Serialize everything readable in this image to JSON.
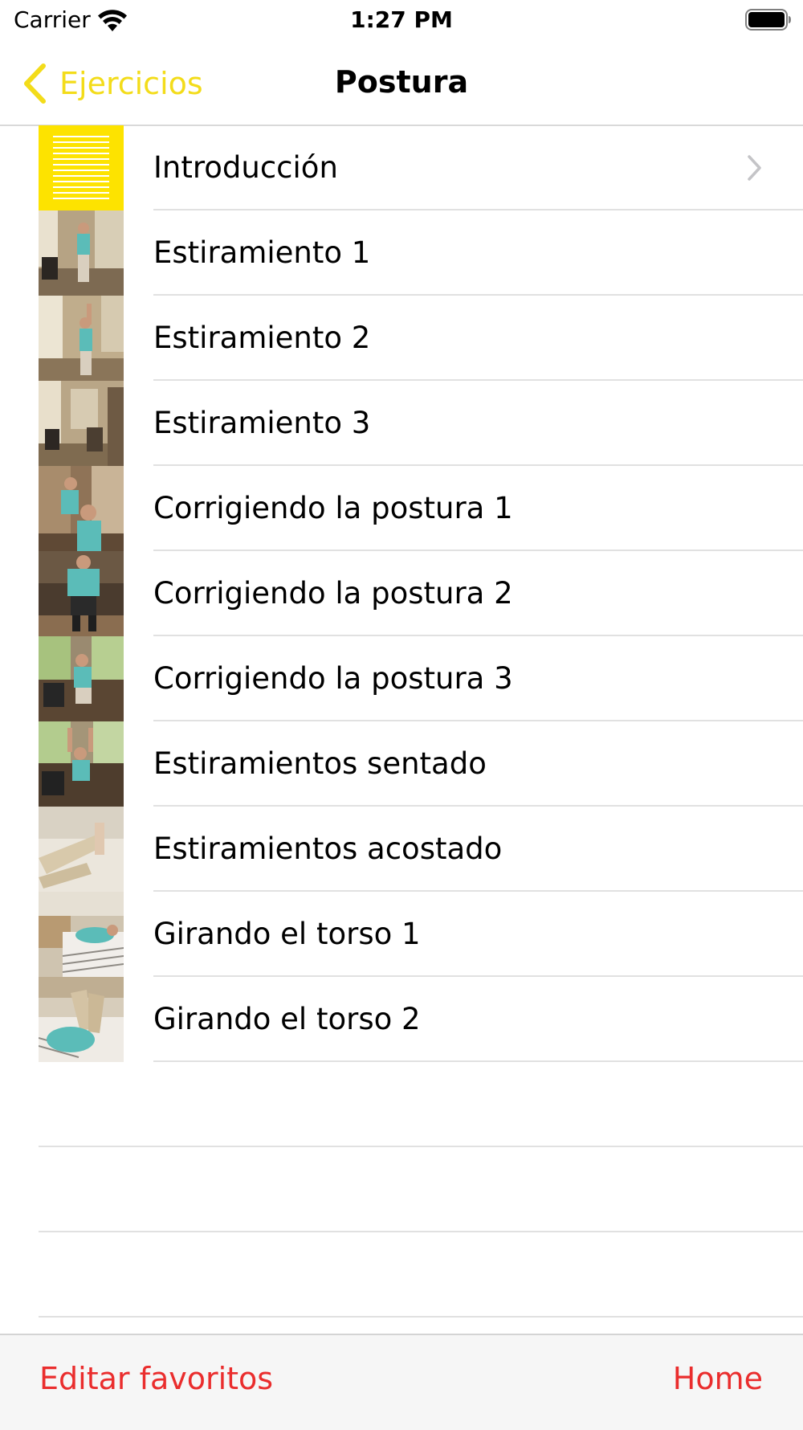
{
  "status": {
    "carrier": "Carrier",
    "time": "1:27 PM",
    "wifi_icon": "wifi-icon",
    "battery_icon": "battery-icon"
  },
  "nav": {
    "back_label": "Ejercicios",
    "title": "Postura"
  },
  "rows": [
    {
      "label": "Introducción",
      "thumb": "list-icon"
    },
    {
      "label": "Estiramiento 1",
      "thumb": "video-thumbnail"
    },
    {
      "label": "Estiramiento 2",
      "thumb": "video-thumbnail"
    },
    {
      "label": "Estiramiento 3",
      "thumb": "video-thumbnail"
    },
    {
      "label": "Corrigiendo la postura 1",
      "thumb": "video-thumbnail"
    },
    {
      "label": "Corrigiendo la postura 2",
      "thumb": "video-thumbnail"
    },
    {
      "label": "Corrigiendo la postura 3",
      "thumb": "video-thumbnail"
    },
    {
      "label": "Estiramientos sentado",
      "thumb": "video-thumbnail"
    },
    {
      "label": "Estiramientos acostado",
      "thumb": "video-thumbnail"
    },
    {
      "label": "Girando el torso 1",
      "thumb": "video-thumbnail"
    },
    {
      "label": "Girando el torso 2",
      "thumb": "video-thumbnail"
    }
  ],
  "toolbar": {
    "left_label": "Editar favoritos",
    "right_label": "Home"
  },
  "colors": {
    "accent_yellow": "#f3dc1a",
    "thumb_yellow": "#fde300",
    "toolbar_red": "#ea2d2d"
  }
}
